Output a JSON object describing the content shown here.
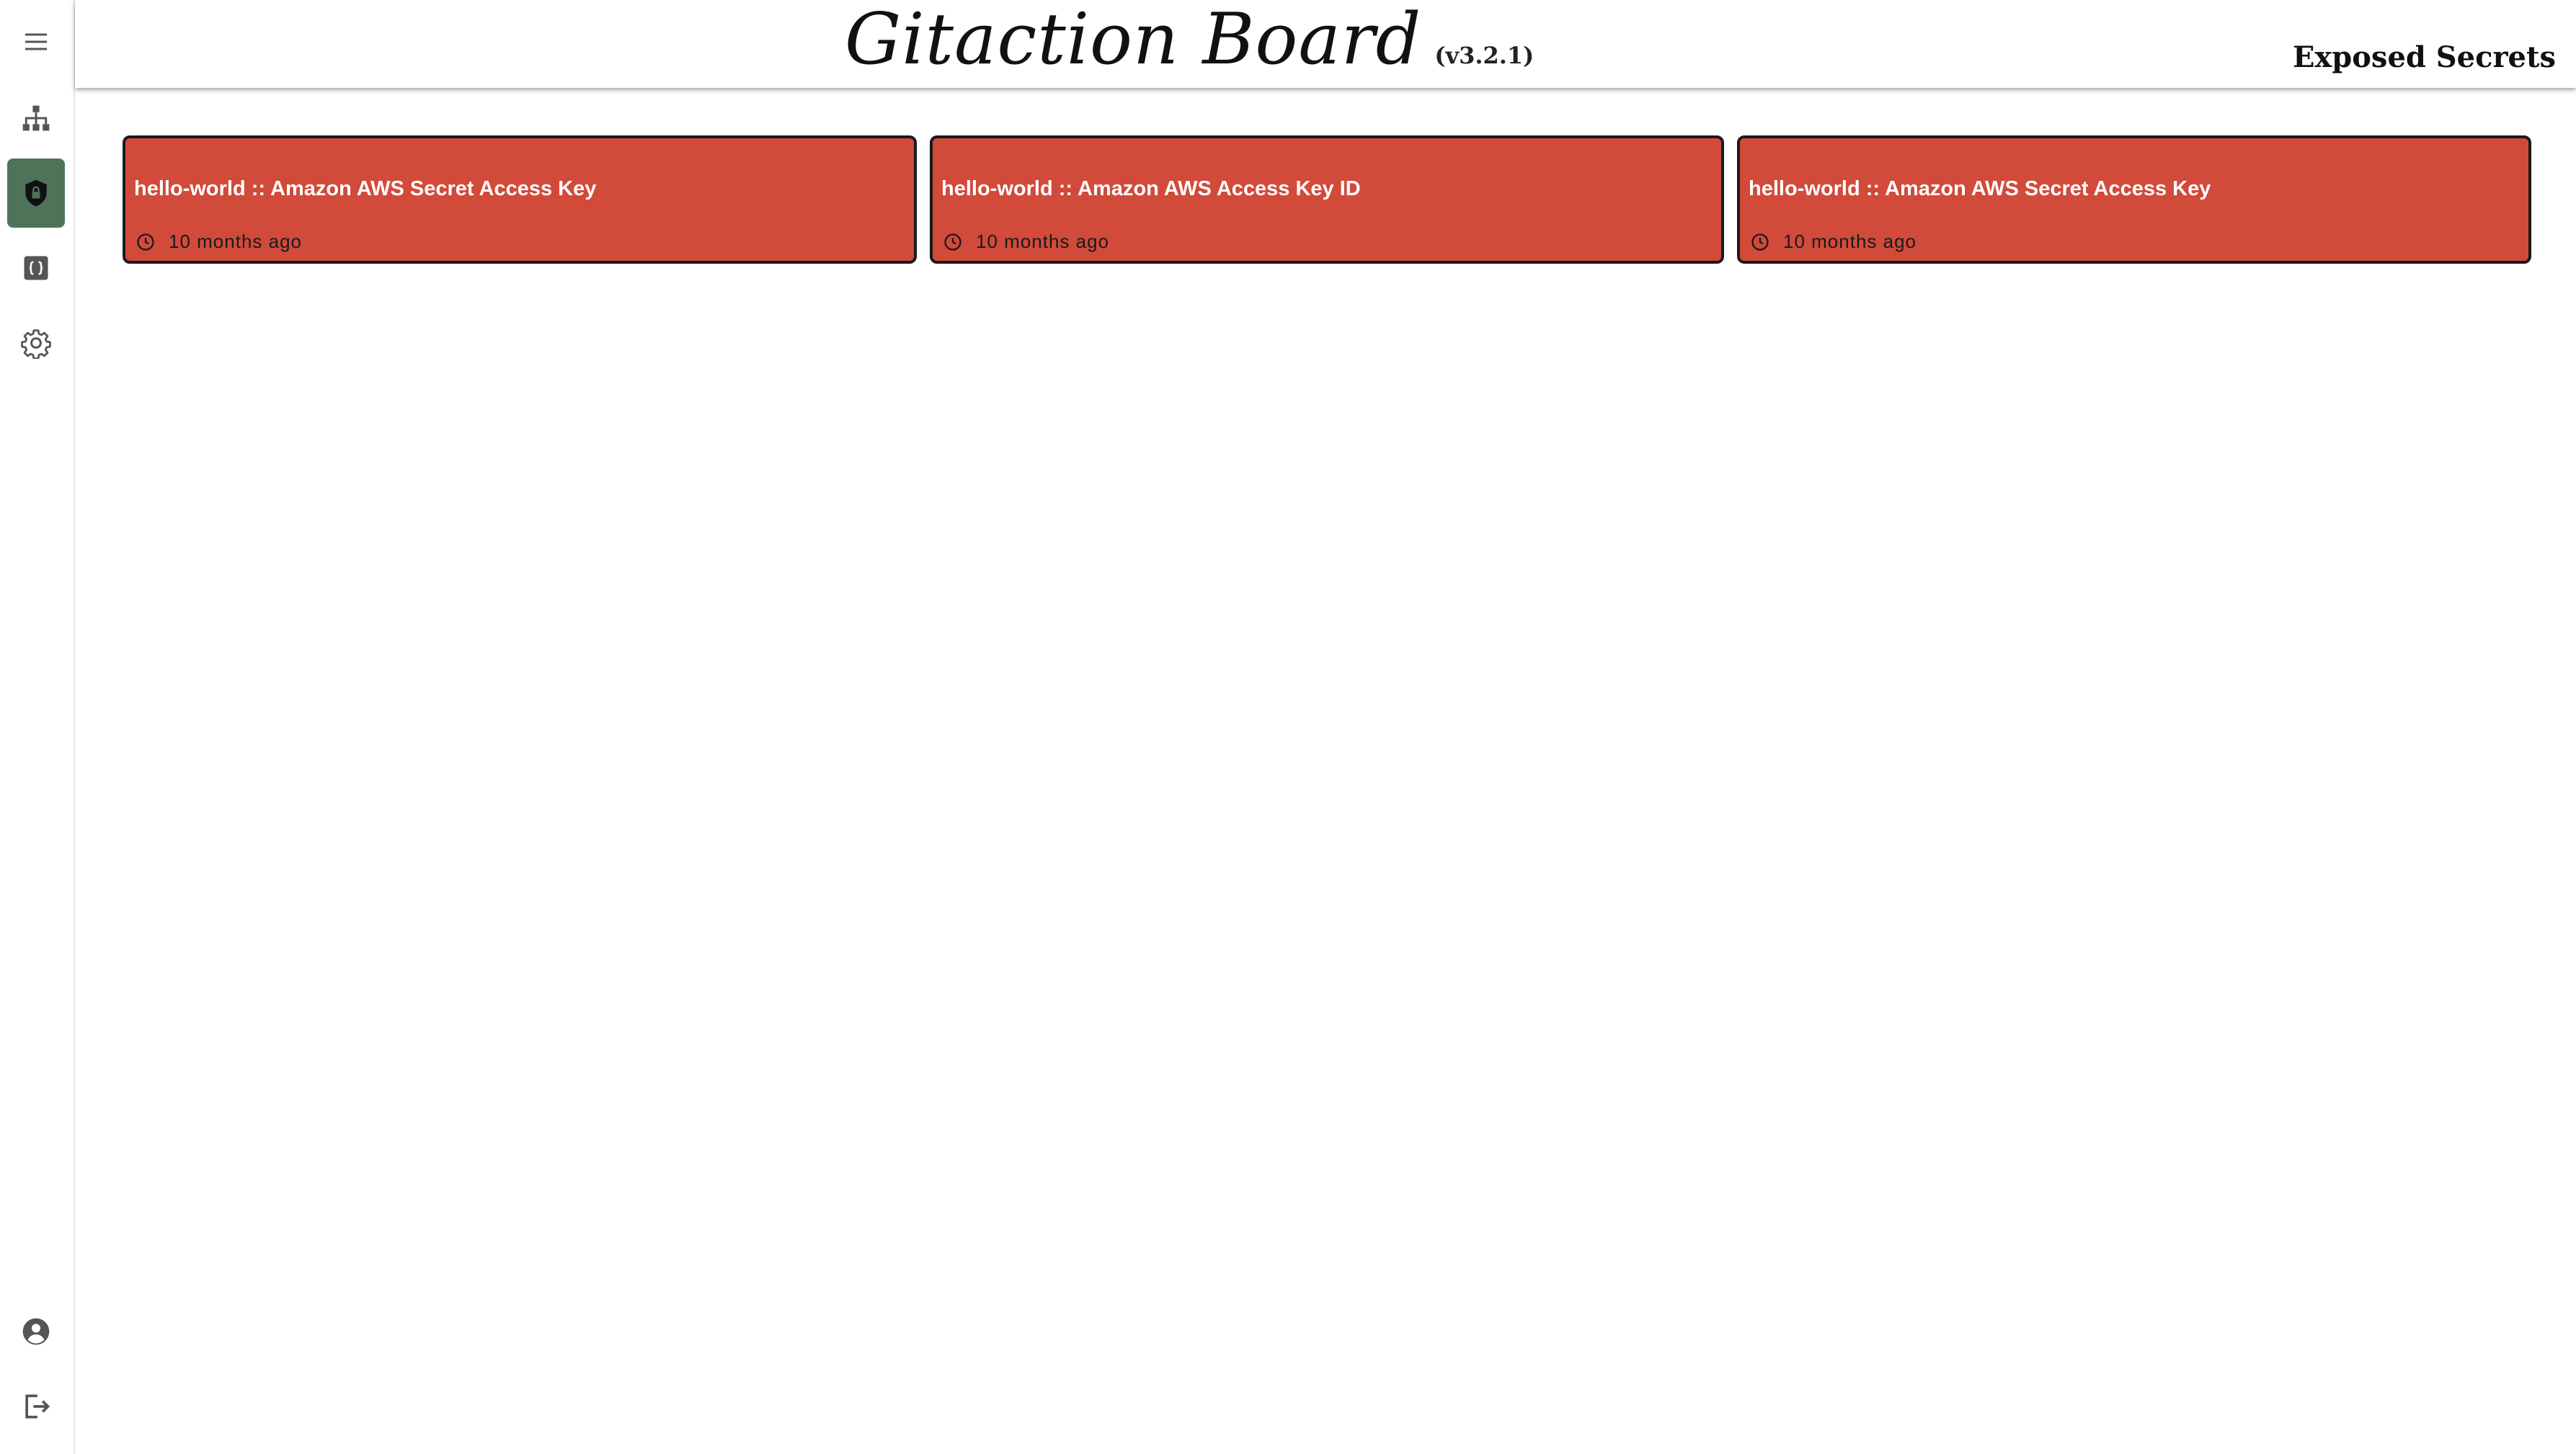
{
  "header": {
    "brand_title": "Gitaction Board",
    "brand_version": "(v3.2.1)",
    "page_heading": "Exposed Secrets"
  },
  "sidebar": {
    "top_items": [
      {
        "name": "menu",
        "icon": "hamburger-menu-icon"
      },
      {
        "name": "workflows",
        "icon": "sitemap-icon"
      },
      {
        "name": "secrets",
        "icon": "shield-lock-icon",
        "active": true
      },
      {
        "name": "code",
        "icon": "code-braces-icon"
      },
      {
        "name": "settings",
        "icon": "gear-icon"
      }
    ],
    "bottom_items": [
      {
        "name": "account",
        "icon": "account-circle-icon"
      },
      {
        "name": "logout",
        "icon": "logout-icon"
      }
    ]
  },
  "secrets": [
    {
      "title": "hello-world :: Amazon AWS Secret Access Key",
      "time": "10 months ago"
    },
    {
      "title": "hello-world :: Amazon AWS Access Key ID",
      "time": "10 months ago"
    },
    {
      "title": "hello-world :: Amazon AWS Secret Access Key",
      "time": "10 months ago"
    }
  ],
  "colors": {
    "card_background": "#d14a3a",
    "card_border": "#1a1a1a",
    "active_sidebar": "#4f7358"
  }
}
